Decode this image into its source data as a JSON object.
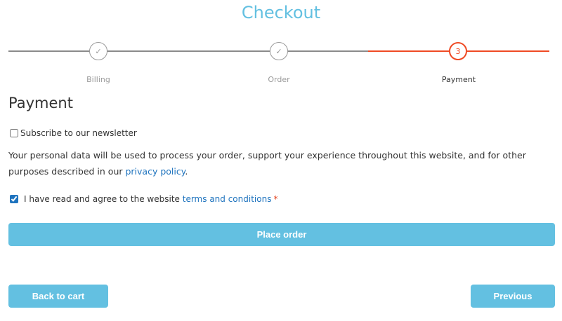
{
  "header": {
    "title": "Checkout"
  },
  "steps": [
    {
      "label": "Billing",
      "state": "done",
      "marker": "✓"
    },
    {
      "label": "Order",
      "state": "done",
      "marker": "✓"
    },
    {
      "label": "Payment",
      "state": "active",
      "marker": "3"
    }
  ],
  "colors": {
    "accent": "#63c0e1",
    "active_step": "#ef4a24",
    "link": "#1e73be",
    "required": "#e2401c"
  },
  "payment": {
    "title": "Payment",
    "newsletter_label": "Subscribe to our newsletter",
    "newsletter_checked": false,
    "privacy_text": "Your personal data will be used to process your order, support your experience throughout this website, and for other purposes described in our",
    "privacy_link": "privacy policy",
    "privacy_end": ".",
    "terms_text": "I have read and agree to the website",
    "terms_link": "terms and conditions",
    "terms_required": "*",
    "terms_checked": true
  },
  "buttons": {
    "place_order": "Place order",
    "back_to_cart": "Back to cart",
    "previous": "Previous"
  }
}
